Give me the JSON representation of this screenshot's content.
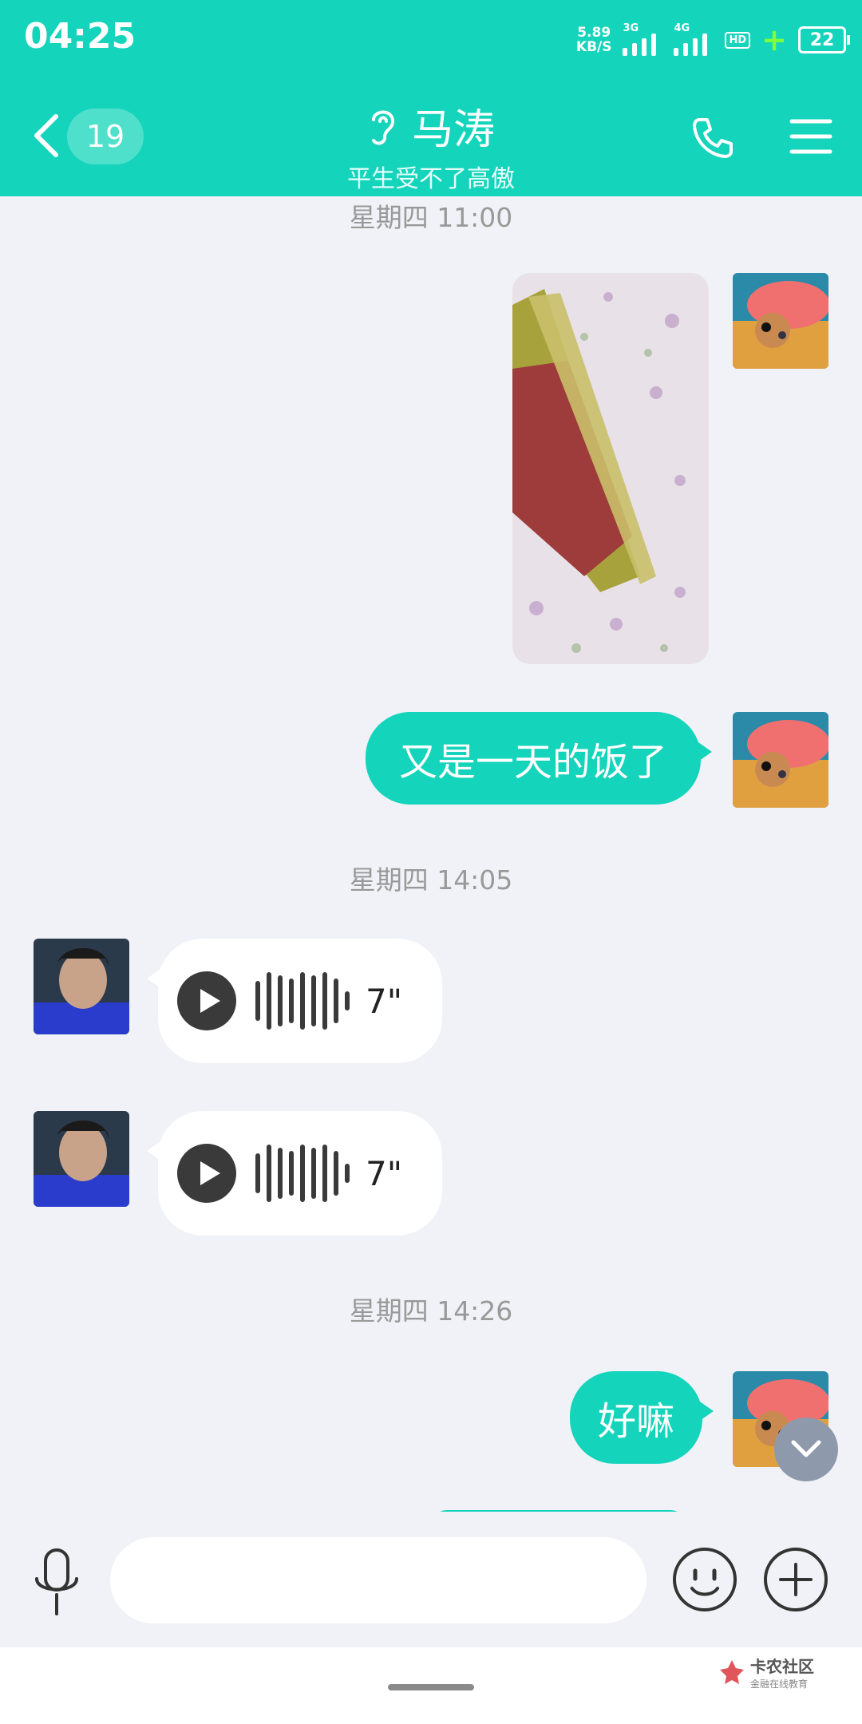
{
  "status_bar": {
    "time": "04:25",
    "net_speed_value": "5.89",
    "net_speed_unit": "KB/S",
    "sim1_label": "3G",
    "sim2_label": "4G",
    "hd_label": "HD",
    "battery": "22"
  },
  "header": {
    "unread_count": "19",
    "title": "马涛",
    "subtitle": "平生受不了高傲"
  },
  "messages": {
    "time1": "星期四 11:00",
    "text1": "又是一天的饭了",
    "time2": "星期四 14:05",
    "voice1_duration": "7\"",
    "voice2_duration": "7\"",
    "time3": "星期四 14:26",
    "text2": "好嘛"
  },
  "input": {
    "placeholder": ""
  },
  "watermark": {
    "main": "卡农社区",
    "sub": "金融在线教育"
  },
  "colors": {
    "accent": "#14d4bb",
    "background": "#f1f2f7"
  }
}
